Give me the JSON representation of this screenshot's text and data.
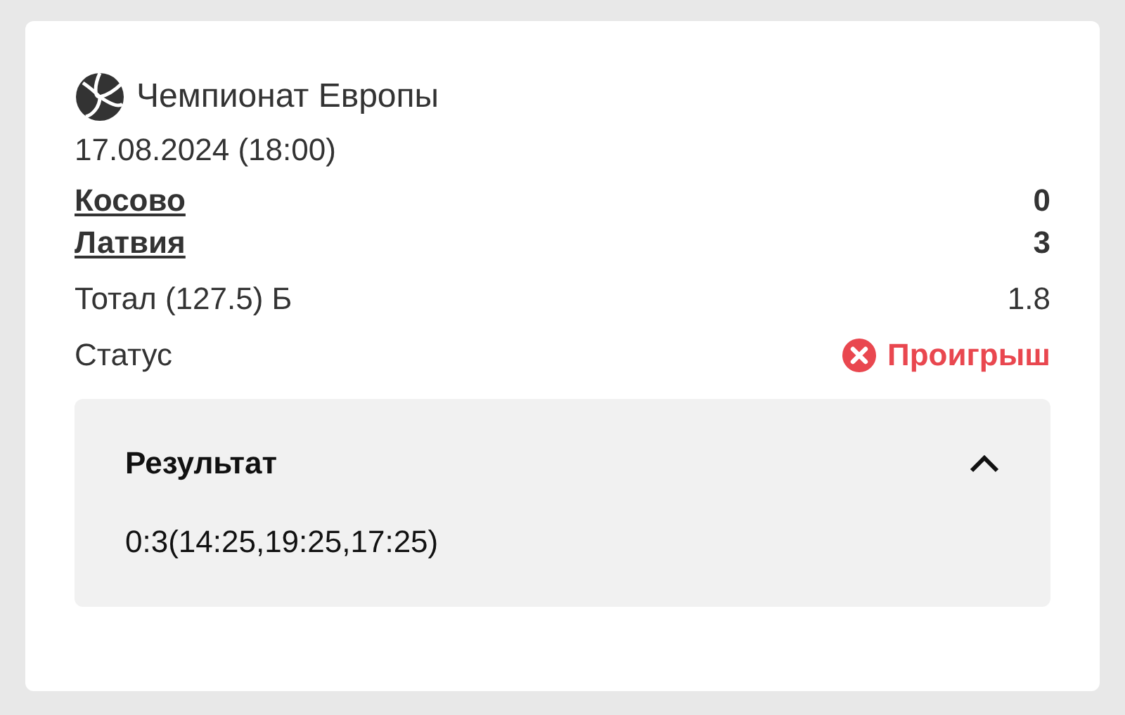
{
  "tournament": "Чемпионат Европы",
  "date": "17.08.2024 (18:00)",
  "teams": [
    {
      "name": "Косово",
      "score": "0"
    },
    {
      "name": "Латвия",
      "score": "3"
    }
  ],
  "bet": {
    "label": "Тотал (127.5) Б",
    "odds": "1.8"
  },
  "status": {
    "label": "Статус",
    "value": "Проигрыш",
    "kind": "loss"
  },
  "result": {
    "title": "Результат",
    "expanded": true,
    "text": "0:3(14:25,19:25,17:25)"
  }
}
